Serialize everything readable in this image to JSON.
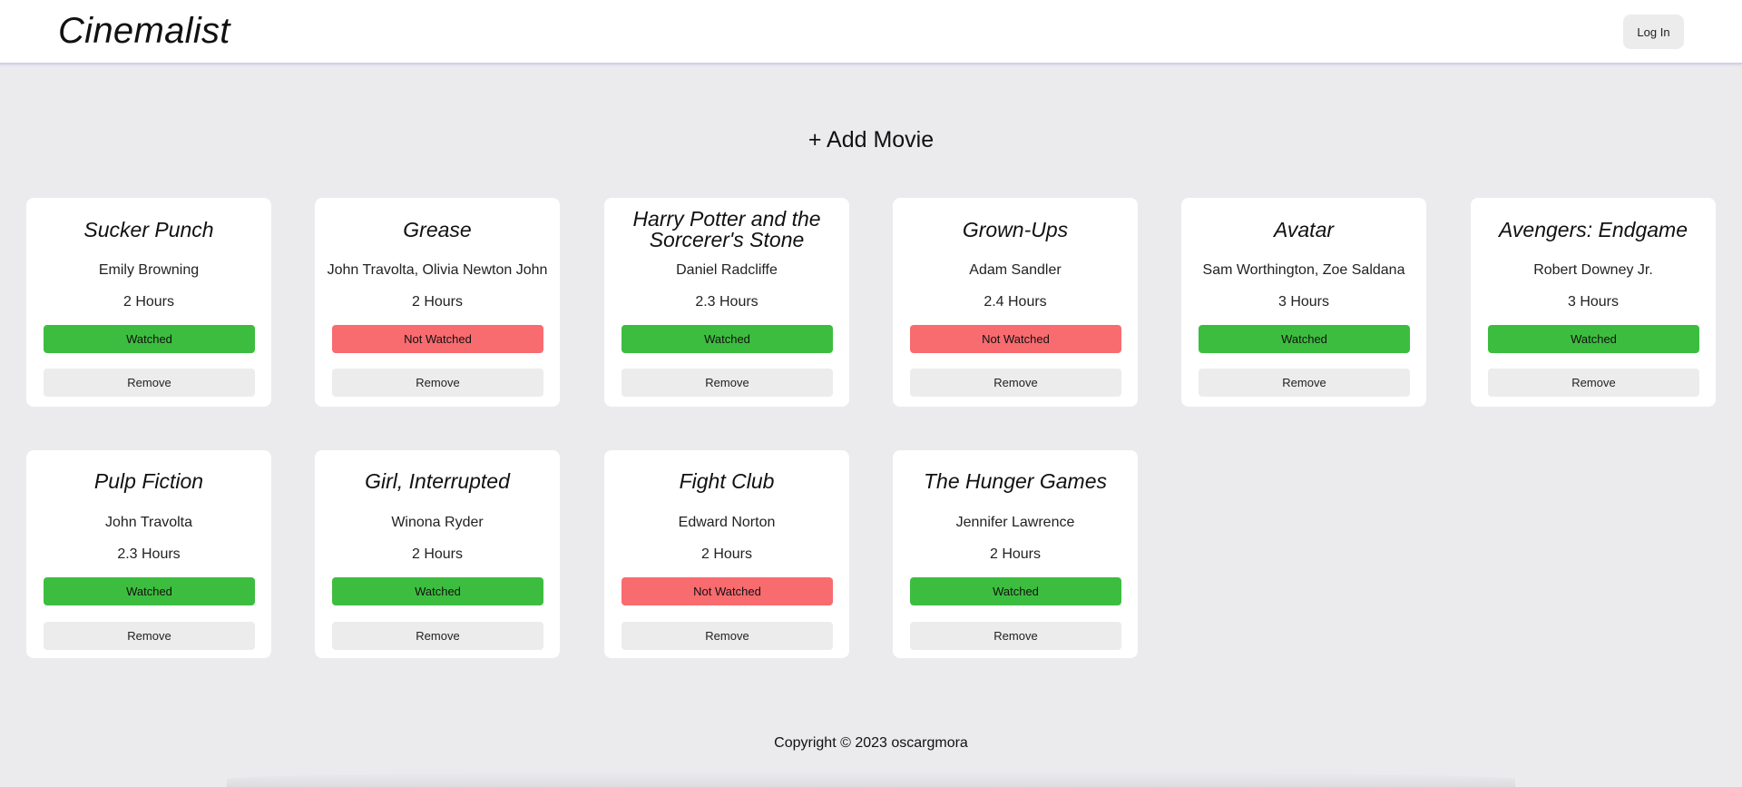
{
  "app": {
    "title": "Cinemalist"
  },
  "header": {
    "login_label": "Log In"
  },
  "actions": {
    "add_movie_label": "+ Add Movie"
  },
  "colors": {
    "watched": "#3dbd3f",
    "not_watched": "#f86b6f",
    "button_gray": "#ececec",
    "page_bg": "#ebeaed"
  },
  "movies": [
    {
      "title": "Sucker Punch",
      "actors": "Emily Browning",
      "duration": "2 Hours",
      "status": "Watched",
      "remove_label": "Remove"
    },
    {
      "title": "Grease",
      "actors": "John Travolta, Olivia Newton John",
      "duration": "2 Hours",
      "status": "Not Watched",
      "remove_label": "Remove"
    },
    {
      "title": "Harry Potter and the Sorcerer's Stone",
      "actors": "Daniel Radcliffe",
      "duration": "2.3 Hours",
      "status": "Watched",
      "remove_label": "Remove"
    },
    {
      "title": "Grown-Ups",
      "actors": "Adam Sandler",
      "duration": "2.4 Hours",
      "status": "Not Watched",
      "remove_label": "Remove"
    },
    {
      "title": "Avatar",
      "actors": "Sam Worthington, Zoe Saldana",
      "duration": "3 Hours",
      "status": "Watched",
      "remove_label": "Remove"
    },
    {
      "title": "Avengers: Endgame",
      "actors": "Robert Downey Jr.",
      "duration": "3 Hours",
      "status": "Watched",
      "remove_label": "Remove"
    },
    {
      "title": "Pulp Fiction",
      "actors": "John Travolta",
      "duration": "2.3 Hours",
      "status": "Watched",
      "remove_label": "Remove"
    },
    {
      "title": "Girl, Interrupted",
      "actors": "Winona Ryder",
      "duration": "2 Hours",
      "status": "Watched",
      "remove_label": "Remove"
    },
    {
      "title": "Fight Club",
      "actors": "Edward Norton",
      "duration": "2 Hours",
      "status": "Not Watched",
      "remove_label": "Remove"
    },
    {
      "title": "The Hunger Games",
      "actors": "Jennifer Lawrence",
      "duration": "2 Hours",
      "status": "Watched",
      "remove_label": "Remove"
    }
  ],
  "footer": {
    "copyright": "Copyright © 2023 oscargmora"
  }
}
